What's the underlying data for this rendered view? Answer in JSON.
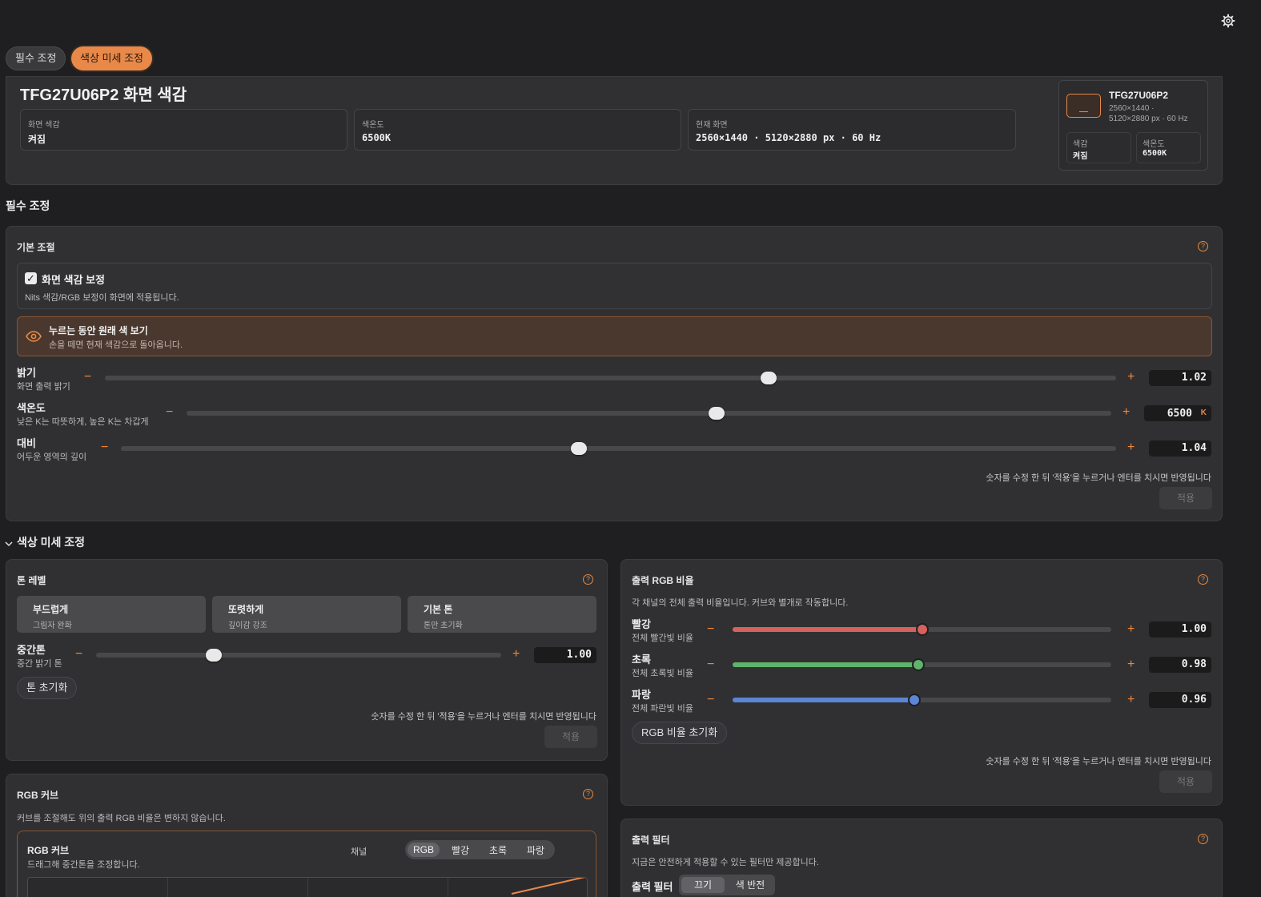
{
  "top_tabs": [
    "필수 조정",
    "색상 미세 조정"
  ],
  "header": {
    "title": "TFG27U06P2 화면 색감",
    "cards": [
      {
        "label": "화면 색감",
        "value": "켜짐"
      },
      {
        "label": "색온도",
        "value": "6500K"
      },
      {
        "label": "현재 화면",
        "value": "2560×1440 · 5120×2880 px · 60 Hz"
      }
    ],
    "monitor_card": {
      "name": "TFG27U06P2",
      "line1": "2560×1440 ·",
      "line2": "5120×2880 px · 60 Hz",
      "stat1_label": "색감",
      "stat1_value": "켜짐",
      "stat2_label": "색온도",
      "stat2_value": "6500K"
    }
  },
  "essential": {
    "section_title": "필수 조정",
    "panel_title": "기본 조절",
    "calibration_title": "화면 색감 보정",
    "calibration_desc": "Nits 색감/RGB 보정이 화면에 적용됩니다.",
    "calibration_checked": true,
    "preview_title": "누르는 동안 원래 색 보기",
    "preview_desc": "손을 떼면 현재 색감으로 돌아옵니다.",
    "sliders": [
      {
        "label": "밝기",
        "sub": "화면 출력 밝기",
        "value": "1.02",
        "fraction": 0.656,
        "unit": ""
      },
      {
        "label": "색온도",
        "sub": "낮은 K는 따뜻하게, 높은 K는 차갑게",
        "value": "6500",
        "fraction": 0.573,
        "unit": "K"
      },
      {
        "label": "대비",
        "sub": "어두운 영역의 깊이",
        "value": "1.04",
        "fraction": 0.46,
        "unit": ""
      }
    ],
    "hint": "숫자를 수정 한 뒤 '적용'을 누르거나 엔터를 치시면 반영됩니다",
    "apply": "적용"
  },
  "fine": {
    "section_title": "색상 미세 조정",
    "tone": {
      "title": "톤 레벨",
      "buttons": [
        {
          "title": "부드럽게",
          "sub": "그림자 완화"
        },
        {
          "title": "또렷하게",
          "sub": "깊이감 강조"
        },
        {
          "title": "기본 톤",
          "sub": "톤만 초기화"
        }
      ],
      "midtone_label": "중간톤",
      "midtone_sub": "중간 밝기 톤",
      "midtone_value": "1.00",
      "midtone_fraction": 0.29,
      "reset": "톤 초기화",
      "hint": "숫자를 수정 한 뒤 '적용'을 누르거나 엔터를 치시면 반영됩니다",
      "apply": "적용"
    },
    "rgb_ratio": {
      "title": "출력 RGB 비율",
      "desc": "각 채널의 전체 출력 비율입니다. 커브와 별개로 작동합니다.",
      "channels": [
        {
          "label": "빨강",
          "sub": "전체 빨간빛 비율",
          "value": "1.00",
          "fraction": 0.5,
          "color": "#d9615c"
        },
        {
          "label": "초록",
          "sub": "전체 초록빛 비율",
          "value": "0.98",
          "fraction": 0.49,
          "color": "#5fb36a"
        },
        {
          "label": "파랑",
          "sub": "전체 파란빛 비율",
          "value": "0.96",
          "fraction": 0.48,
          "color": "#5b86d6"
        }
      ],
      "reset": "RGB 비율 초기화",
      "hint": "숫자를 수정 한 뒤 '적용'을 누르거나 엔터를 치시면 반영됩니다",
      "apply": "적용"
    },
    "curve": {
      "title": "RGB 커브",
      "desc": "커브를 조절해도 위의 출력 RGB 비율은 변하지 않습니다.",
      "inner_title": "RGB 커브",
      "inner_desc": "드래그해 중간톤을 조정합니다.",
      "channel_label": "채널",
      "channels": [
        "RGB",
        "빨강",
        "초록",
        "파랑"
      ],
      "selected_channel": "RGB"
    },
    "filter": {
      "title": "출력 필터",
      "desc": "지금은 안전하게 적용할 수 있는 필터만 제공합니다.",
      "label": "출력 필터",
      "options": [
        "끄기",
        "색 반전"
      ],
      "selected": "끄기"
    }
  },
  "colors": {
    "accent": "#e8894a",
    "background": "#1f1f21",
    "panel": "#303032"
  },
  "icons": {
    "settings": "gear-icon",
    "preview": "eye-icon",
    "help": "help-circle-icon",
    "collapse": "chevron-down-icon"
  }
}
